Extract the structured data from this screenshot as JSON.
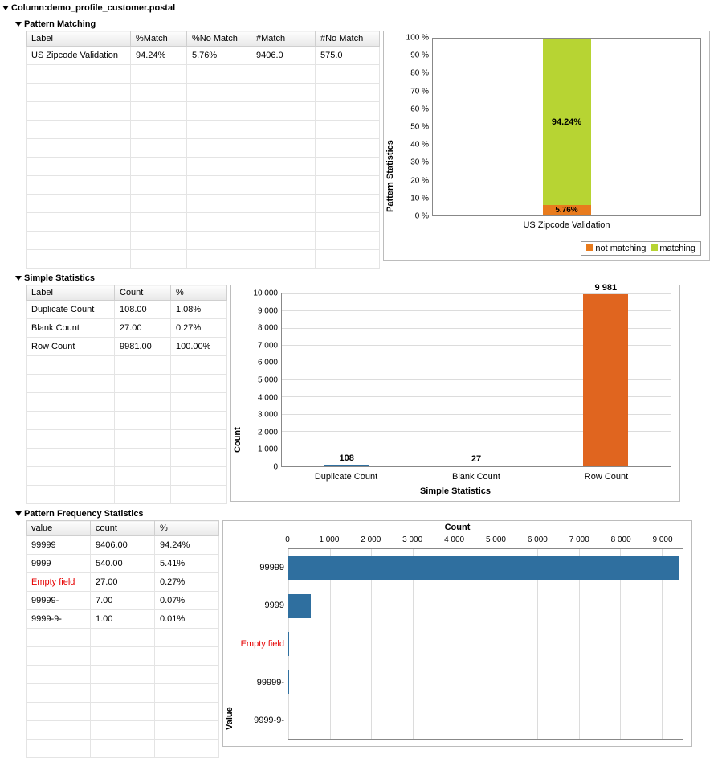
{
  "title": "Column:demo_profile_customer.postal",
  "sections": {
    "pattern_matching": {
      "title": "Pattern Matching",
      "table": {
        "headers": [
          "Label",
          "%Match",
          "%No Match",
          "#Match",
          "#No Match"
        ],
        "rows": [
          {
            "label": "US Zipcode Validation",
            "pmatch": "94.24%",
            "pnomatch": "5.76%",
            "nmatch": "9406.0",
            "nnomatch": "575.0"
          }
        ]
      },
      "chart": {
        "ylabel": "Pattern Statistics",
        "xcat": "US Zipcode Validation",
        "match_label": "94.24%",
        "nomatch_label": "5.76%",
        "legend_not": "not matching",
        "legend_match": "matching"
      }
    },
    "simple_stats": {
      "title": "Simple Statistics",
      "table": {
        "headers": [
          "Label",
          "Count",
          "%"
        ],
        "rows": [
          {
            "label": "Duplicate Count",
            "count": "108.00",
            "pct": "1.08%"
          },
          {
            "label": "Blank Count",
            "count": "27.00",
            "pct": "0.27%"
          },
          {
            "label": "Row Count",
            "count": "9981.00",
            "pct": "100.00%"
          }
        ]
      },
      "chart": {
        "ylabel": "Count",
        "xlabel": "Simple Statistics",
        "cats": [
          "Duplicate Count",
          "Blank Count",
          "Row Count"
        ],
        "labels": [
          "108",
          "27",
          "9 981"
        ]
      }
    },
    "pattern_freq": {
      "title": "Pattern Frequency Statistics",
      "table": {
        "headers": [
          "value",
          "count",
          "%"
        ],
        "rows": [
          {
            "value": "99999",
            "count": "9406.00",
            "pct": "94.24%",
            "red": false
          },
          {
            "value": "9999",
            "count": "540.00",
            "pct": "5.41%",
            "red": false
          },
          {
            "value": "Empty field",
            "count": "27.00",
            "pct": "0.27%",
            "red": true
          },
          {
            "value": "99999-",
            "count": "7.00",
            "pct": "0.07%",
            "red": false
          },
          {
            "value": "9999-9-",
            "count": "1.00",
            "pct": "0.01%",
            "red": false
          }
        ]
      },
      "chart": {
        "xlabel": "Count",
        "ylabel": "Value",
        "ticks": [
          "0",
          "1 000",
          "2 000",
          "3 000",
          "4 000",
          "5 000",
          "6 000",
          "7 000",
          "8 000",
          "9 000"
        ]
      }
    }
  },
  "chart_data": [
    {
      "type": "bar",
      "orientation": "vertical-stacked",
      "title": "",
      "xlabel": "",
      "ylabel": "Pattern Statistics",
      "categories": [
        "US Zipcode Validation"
      ],
      "series": [
        {
          "name": "not matching",
          "values": [
            5.76
          ],
          "color": "#e87b1d"
        },
        {
          "name": "matching",
          "values": [
            94.24
          ],
          "color": "#b7d433"
        }
      ],
      "ylim": [
        0,
        100
      ],
      "yunit": "%"
    },
    {
      "type": "bar",
      "orientation": "vertical",
      "title": "",
      "xlabel": "Simple Statistics",
      "ylabel": "Count",
      "categories": [
        "Duplicate Count",
        "Blank Count",
        "Row Count"
      ],
      "series": [
        {
          "name": "Count",
          "values": [
            108,
            27,
            9981
          ],
          "colors": [
            "#2f6f9f",
            "#e7e24e",
            "#e0651f"
          ]
        }
      ],
      "ylim": [
        0,
        10000
      ]
    },
    {
      "type": "bar",
      "orientation": "horizontal",
      "title": "",
      "xlabel": "Count",
      "ylabel": "Value",
      "categories": [
        "99999",
        "9999",
        "Empty field",
        "99999-",
        "9999-9-"
      ],
      "series": [
        {
          "name": "count",
          "values": [
            9406,
            540,
            27,
            7,
            1
          ],
          "color": "#2f6f9f"
        }
      ],
      "xlim": [
        0,
        9500
      ]
    }
  ]
}
